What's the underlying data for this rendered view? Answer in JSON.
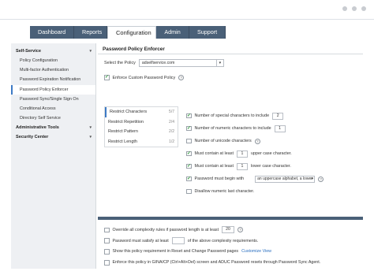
{
  "nav": {
    "tabs": [
      {
        "label": "Dashboard"
      },
      {
        "label": "Reports"
      },
      {
        "label": "Configuration"
      },
      {
        "label": "Admin"
      },
      {
        "label": "Support"
      }
    ]
  },
  "sidebar": {
    "self_service": "Self-Service",
    "items": [
      "Policy Configuration",
      "Multi-factor Authentication",
      "Password Expiration Notification",
      "Password Policy Enforcer",
      "Password Sync/Single Sign On",
      "Conditional Access",
      "Directory Self Service"
    ],
    "admin_tools": "Administrative Tools",
    "security_center": "Security Center"
  },
  "panel": {
    "title": "Password Policy Enforcer",
    "select_label": "Select the Policy",
    "select_value": "adselfservice.com",
    "enforce_label": "Enforce Custom Password Policy"
  },
  "categories": [
    {
      "label": "Restrict Characters",
      "count": "5/7"
    },
    {
      "label": "Restrict Repetition",
      "count": "2/4"
    },
    {
      "label": "Restrict Pattern",
      "count": "2/2"
    },
    {
      "label": "Restrict Length",
      "count": "1/2"
    }
  ],
  "rules": {
    "special_label": "Number of special characters to include",
    "special_value": "2",
    "numeric_label": "Number of numeric characters to include",
    "numeric_value": "1",
    "unicode_label": "Number of unicode characters",
    "upper_prefix": "Must contain at least",
    "upper_value": "1",
    "upper_suffix": "upper case character.",
    "lower_prefix": "Must contain at least",
    "lower_value": "1",
    "lower_suffix": "lower case character.",
    "begin_label": "Password must begin with",
    "begin_value": "an uppercase alphabet, a lower",
    "disallow_label": "Disallow numeric last character."
  },
  "bottom": {
    "override_label": "Override all complexity rules if password length is at least",
    "override_value": "20",
    "satisfy_prefix": "Password must satisfy at least",
    "satisfy_suffix": "of the above complexity requirements.",
    "show_label": "Show this policy requirement in Reset and Change Password pages",
    "customize_link": "Customize View",
    "enforce_gina_label": "Enforce this policy in GINA/CP (Ctrl+Alt+Del) screen and ADUC Password resets through Password Sync Agent."
  },
  "icons": {
    "help": "?",
    "caret_down": "▾",
    "check": "✓"
  }
}
